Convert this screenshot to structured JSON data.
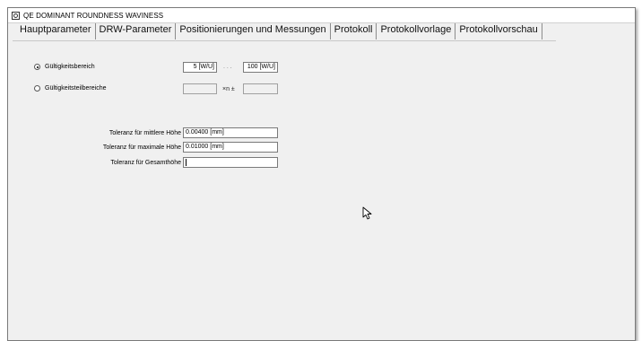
{
  "window": {
    "title": "QE DOMINANT ROUNDNESS WAVINESS"
  },
  "tabs": [
    {
      "label": "Hauptparameter",
      "active": false
    },
    {
      "label": "DRW-Parameter",
      "active": true
    },
    {
      "label": "Positionierungen und Messungen",
      "active": false
    },
    {
      "label": "Protokoll",
      "active": false
    },
    {
      "label": "Protokollvorlage",
      "active": false
    },
    {
      "label": "Protokollvorschau",
      "active": false
    }
  ],
  "range_option": {
    "label": "Gültigkeitsbereich",
    "checked": true,
    "from_value": "5 [W/U]",
    "separator": ". . .",
    "to_value": "100 [W/U]"
  },
  "partial_range_option": {
    "label": "Gültigkeitsteilbereiche",
    "checked": false,
    "value_a": "",
    "multiplier_label": "×n ±",
    "value_b": ""
  },
  "tolerances": {
    "mean_height": {
      "label": "Toleranz für mittlere Höhe",
      "value": "0.00400 [mm]"
    },
    "max_height": {
      "label": "Toleranz für maximale Höhe",
      "value": "0.01000 [mm]"
    },
    "total_height": {
      "label": "Toleranz für Gesamthöhe",
      "value": ""
    }
  }
}
